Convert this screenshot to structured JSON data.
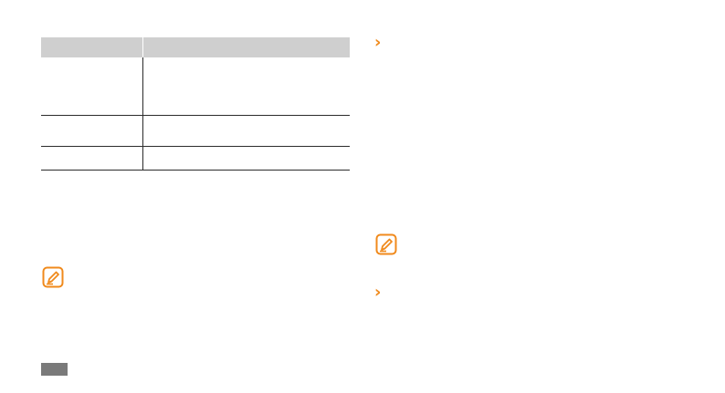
{
  "table": {
    "header": [
      "",
      ""
    ],
    "rows": [
      [
        "",
        ""
      ],
      [
        "",
        ""
      ],
      [
        "",
        ""
      ]
    ]
  },
  "icons": {
    "note_left": "note-pencil-icon",
    "note_right": "note-pencil-icon",
    "chevron_top": "chevron-right-icon",
    "chevron_bottom": "chevron-right-icon"
  },
  "chevron_glyph": "›",
  "page_number": "",
  "colors": {
    "accent": "#f08a1c",
    "table_header": "#cfcfcf",
    "page_tab": "#7a7a7a"
  }
}
